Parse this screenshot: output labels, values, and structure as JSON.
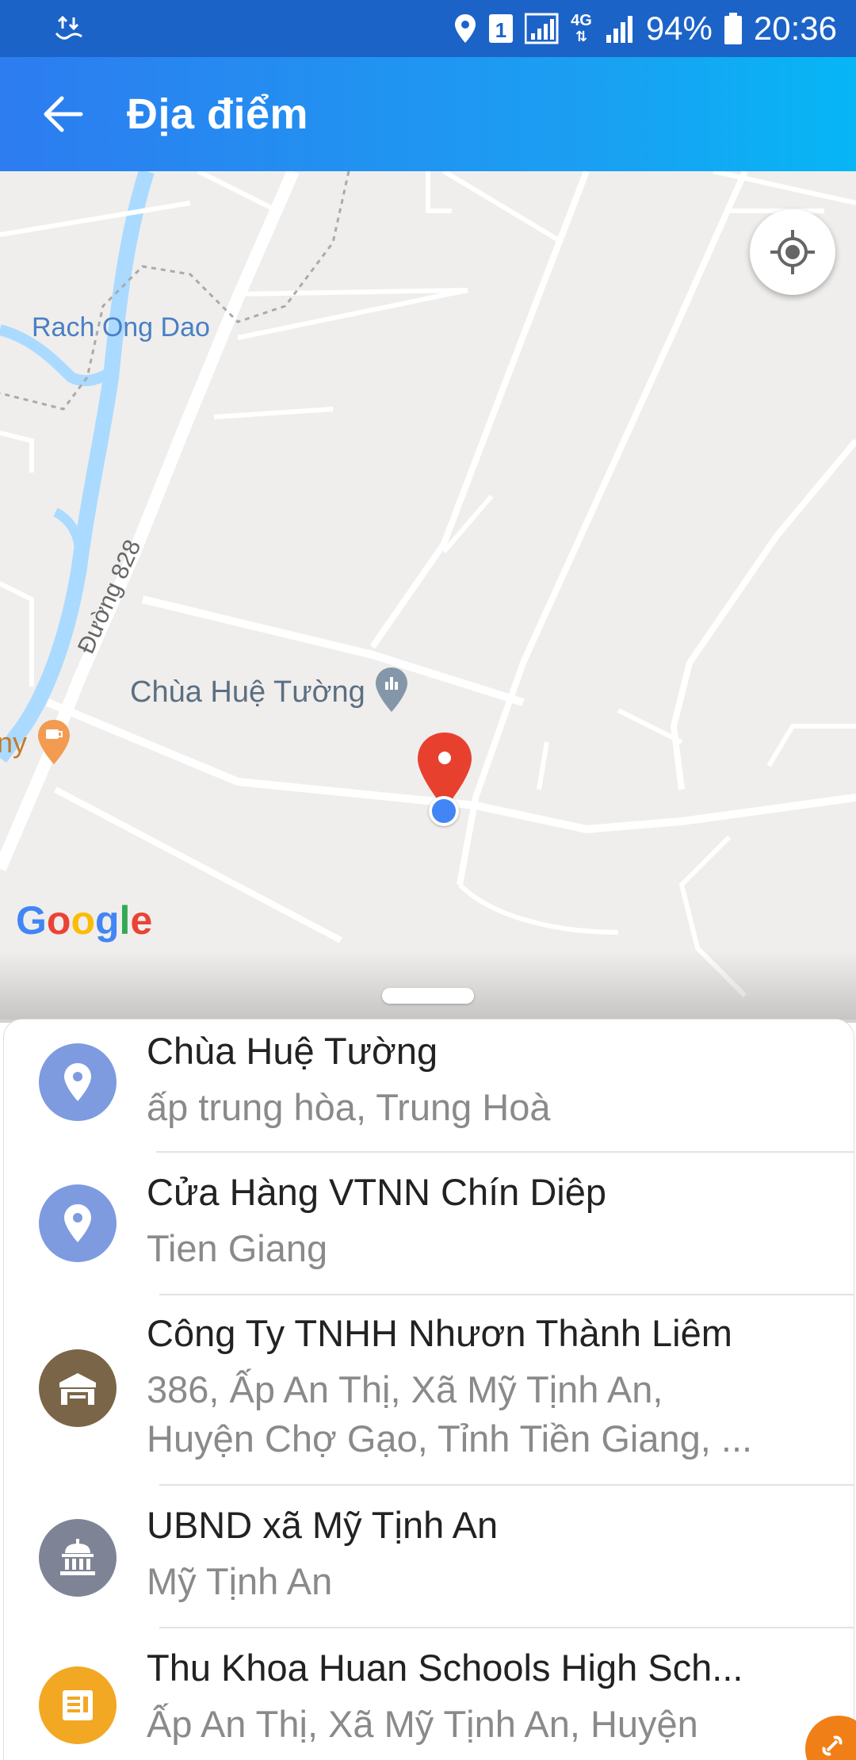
{
  "status_bar": {
    "battery": "94%",
    "time": "20:36",
    "sim_slot": "1",
    "network": "4G",
    "icons": [
      "sync-icon",
      "location-icon",
      "sim-icon",
      "signal-icon",
      "data-icon",
      "signal-icon",
      "battery-icon"
    ]
  },
  "app_bar": {
    "title": "Địa điểm",
    "back_icon": "arrow-left-icon"
  },
  "map": {
    "labels": {
      "canal": "Rach Ong Dao",
      "road": "Đường 828",
      "poi": "Chùa Huệ Tường",
      "partial_left": "ny"
    },
    "logo": {
      "G": "G",
      "o1": "o",
      "o2": "o",
      "g": "g",
      "l": "l",
      "e": "e"
    },
    "colors": {
      "background": "#efeeec",
      "road": "#ffffff",
      "water": "#aadaff",
      "pin": "#e8402f",
      "current_location": "#4285f4"
    }
  },
  "places": [
    {
      "name": "Chùa Huệ Tường",
      "address": "ấp trung hòa, Trung Hoà",
      "icon": "location-pin-icon",
      "color": "#7e9be0"
    },
    {
      "name": "Cửa Hàng VTNN Chín Diêp",
      "address": "Tien Giang",
      "icon": "location-pin-icon",
      "color": "#7e9be0"
    },
    {
      "name": "Công Ty TNHH Nhươn Thành Liêm",
      "address_line1": "386, Ấp An Thị, Xã Mỹ Tịnh An,",
      "address_line2": "Huyện Chợ Gạo, Tỉnh Tiền Giang, ...",
      "icon": "store-icon",
      "color": "#7b6548"
    },
    {
      "name": "UBND xã Mỹ Tịnh An",
      "address": "Mỹ Tịnh An",
      "icon": "government-building-icon",
      "color": "#7e8496"
    },
    {
      "name": "Thu Khoa Huan Schools High Sch...",
      "address": "Ấp An Thị, Xã Mỹ Tịnh An, Huyện",
      "icon": "school-icon",
      "color": "#f2a823"
    }
  ]
}
